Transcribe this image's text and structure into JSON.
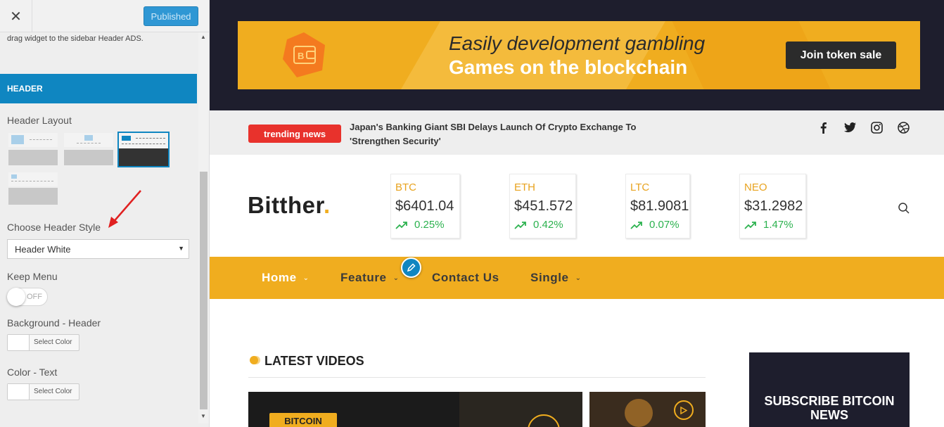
{
  "colors": {
    "accent": "#0f86c1",
    "brand_yellow": "#f0ad1f",
    "dark": "#1e1e2d",
    "trend_red": "#e8322c",
    "up_green": "#2cb24f"
  },
  "customizer": {
    "close_icon": "close-icon",
    "publish_label": "Published",
    "note": "drag widget to the sidebar Header ADS.",
    "section_title": "HEADER",
    "header_layout_label": "Header Layout",
    "layouts": [
      {
        "selected": false
      },
      {
        "selected": false
      },
      {
        "selected": true
      },
      {
        "selected": false
      }
    ],
    "header_style_label": "Choose Header Style",
    "header_style_value": "Header White",
    "keep_menu_label": "Keep Menu",
    "keep_menu_toggle": "OFF",
    "bg_header_label": "Background - Header",
    "bg_header_button": "Select Color",
    "color_text_label": "Color - Text",
    "color_text_button": "Select Color"
  },
  "site": {
    "banner": {
      "line1": "Easily development gambling",
      "line2": "Games on the blockchain",
      "button": "Join token sale"
    },
    "trending": {
      "badge": "trending news",
      "headline": "Japan's Banking Giant SBI Delays Launch Of Crypto Exchange To 'Strengthen Security'"
    },
    "social": [
      "facebook-icon",
      "twitter-icon",
      "instagram-icon",
      "dribbble-icon"
    ],
    "logo": {
      "name": "Bitther",
      "dot": "."
    },
    "tickers": [
      {
        "symbol": "BTC",
        "price": "$6401.04",
        "change": "0.25%"
      },
      {
        "symbol": "ETH",
        "price": "$451.572",
        "change": "0.42%"
      },
      {
        "symbol": "LTC",
        "price": "$81.9081",
        "change": "0.07%"
      },
      {
        "symbol": "NEO",
        "price": "$31.2982",
        "change": "1.47%"
      }
    ],
    "nav": [
      {
        "label": "Home",
        "has_dropdown": true
      },
      {
        "label": "Feature",
        "has_dropdown": true
      },
      {
        "label": "Contact Us",
        "has_dropdown": false
      },
      {
        "label": "Single",
        "has_dropdown": true
      }
    ],
    "latest_videos_title": "LATEST VIDEOS",
    "video_category": "BITCOIN",
    "subscribe_title": "SUBSCRIBE BITCOIN NEWS"
  }
}
